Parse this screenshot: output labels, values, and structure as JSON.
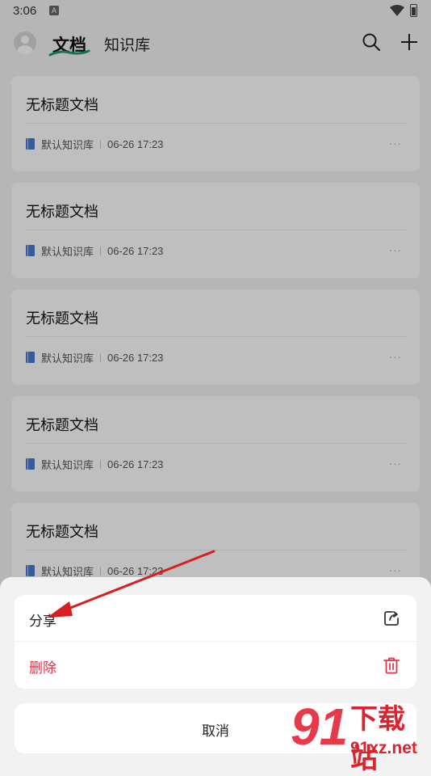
{
  "status_bar": {
    "time": "3:06",
    "notification_glyph": "A"
  },
  "header": {
    "tabs": [
      {
        "label": "文档",
        "active": true
      },
      {
        "label": "知识库",
        "active": false
      }
    ]
  },
  "documents": [
    {
      "title": "无标题文档",
      "library": "默认知识库",
      "time": "06-26 17:23"
    },
    {
      "title": "无标题文档",
      "library": "默认知识库",
      "time": "06-26 17:23"
    },
    {
      "title": "无标题文档",
      "library": "默认知识库",
      "time": "06-26 17:23"
    },
    {
      "title": "无标题文档",
      "library": "默认知识库",
      "time": "06-26 17:23"
    },
    {
      "title": "无标题文档",
      "library": "默认知识库",
      "time": "06-26 17:23"
    }
  ],
  "more_glyph": "···",
  "action_sheet": {
    "share_label": "分享",
    "delete_label": "删除",
    "cancel_label": "取消"
  },
  "watermark": {
    "logo": "91",
    "name": "下载站",
    "url": "91xz.net"
  },
  "colors": {
    "accent_green": "#1a9b6a",
    "danger": "#e0334b",
    "arrow": "#d81e1e",
    "book": "#4a7bd1"
  }
}
